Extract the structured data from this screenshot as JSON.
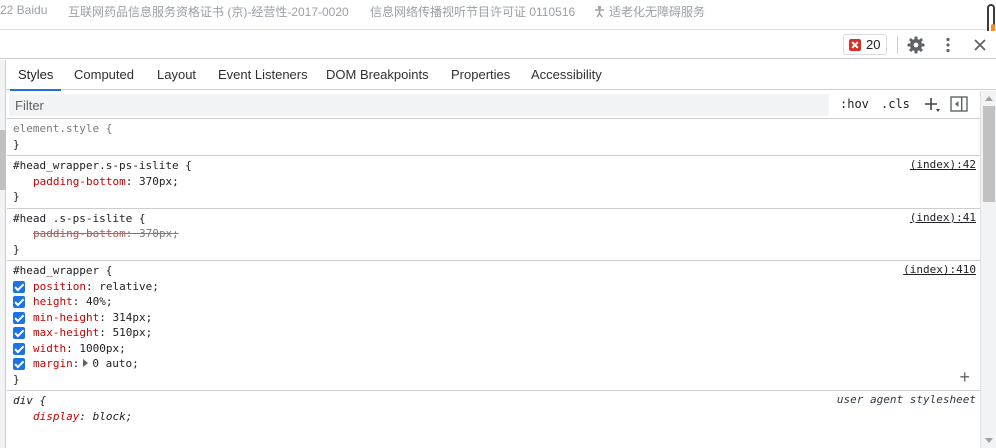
{
  "page_footer": {
    "baidu_text": "22 Baidu",
    "license_drug": "互联网药品信息服务资格证书 (京)-经营性-2017-0020",
    "license_video": "信息网络传播视听节目许可证 0110516",
    "accessibility_text": "适老化无障碍服务"
  },
  "toolbar": {
    "issues_count": "20"
  },
  "tabs": [
    {
      "label": "Styles",
      "active": true
    },
    {
      "label": "Computed"
    },
    {
      "label": "Layout"
    },
    {
      "label": "Event Listeners"
    },
    {
      "label": "DOM Breakpoints"
    },
    {
      "label": "Properties"
    },
    {
      "label": "Accessibility"
    }
  ],
  "filter": {
    "placeholder": "Filter",
    "hov": ":hov",
    "cls": ".cls"
  },
  "rules": [
    {
      "selector": "element.style {",
      "close": "}",
      "declarations": []
    },
    {
      "selector": "#head_wrapper.s-ps-islite {",
      "source": "(index):42",
      "close": "}",
      "declarations": [
        {
          "name": "padding-bottom",
          "value": "370px"
        }
      ]
    },
    {
      "selector": "#head .s-ps-islite {",
      "source": "(index):41",
      "close": "}",
      "declarations": [
        {
          "name": "padding-bottom",
          "value": "370px",
          "overridden": true
        }
      ]
    },
    {
      "selector": "#head_wrapper {",
      "source": "(index):410",
      "close": "}",
      "declarations": [
        {
          "name": "position",
          "value": "relative"
        },
        {
          "name": "height",
          "value": "40%"
        },
        {
          "name": "min-height",
          "value": "314px"
        },
        {
          "name": "max-height",
          "value": "510px"
        },
        {
          "name": "width",
          "value": "1000px"
        },
        {
          "name": "margin",
          "value": "0 auto"
        }
      ]
    },
    {
      "selector": "div {",
      "source": "user agent stylesheet",
      "declarations": [
        {
          "name": "display",
          "value": "block"
        }
      ]
    }
  ],
  "colors": {
    "accent": "#1a73e8",
    "property_name": "#c80000",
    "error": "#d93025"
  }
}
